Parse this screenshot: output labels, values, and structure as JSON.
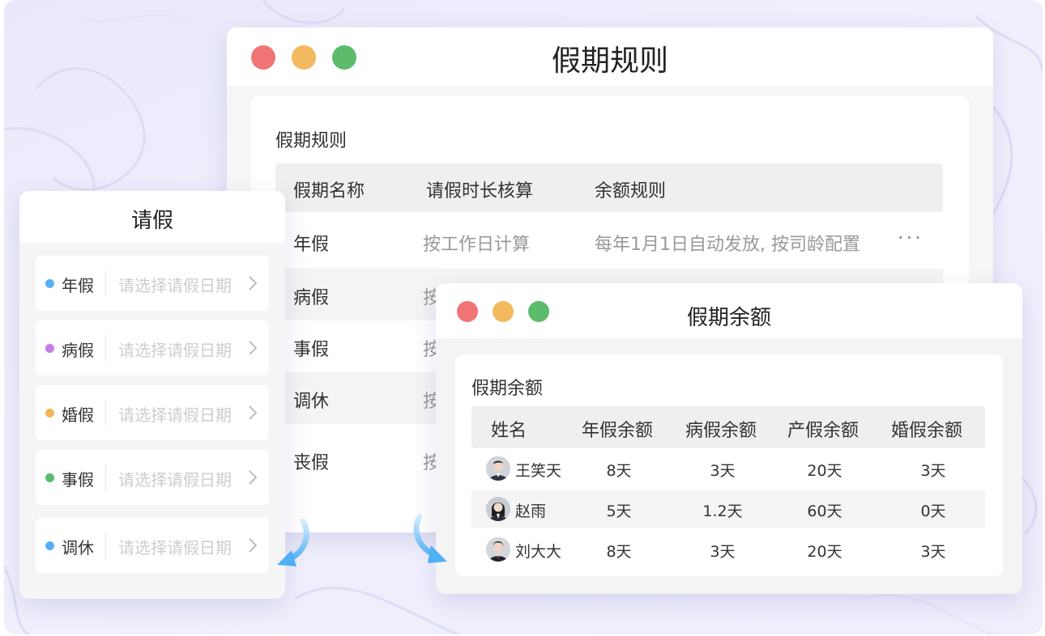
{
  "rules_window": {
    "title": "假期规则",
    "heading": "假期规则",
    "columns": [
      "假期名称",
      "请假时长核算",
      "余额规则"
    ],
    "rows": [
      {
        "name": "年假",
        "calc": "按工作日计算",
        "rule": "每年1月1日自动发放, 按司龄配置"
      },
      {
        "name": "病假",
        "calc": "按",
        "rule": ""
      },
      {
        "name": "事假",
        "calc": "按",
        "rule": ""
      },
      {
        "name": "调休",
        "calc": "按",
        "rule": ""
      },
      {
        "name": "丧假",
        "calc": "按",
        "rule": ""
      }
    ],
    "more_label": "···"
  },
  "leave_window": {
    "title": "请假",
    "items": [
      {
        "type": "年假",
        "placeholder": "请选择请假日期",
        "dot_color": "#5aaef5"
      },
      {
        "type": "病假",
        "placeholder": "请选择请假日期",
        "dot_color": "#c57be8"
      },
      {
        "type": "婚假",
        "placeholder": "请选择请假日期",
        "dot_color": "#f2b857"
      },
      {
        "type": "事假",
        "placeholder": "请选择请假日期",
        "dot_color": "#5cbc6b"
      },
      {
        "type": "调休",
        "placeholder": "请选择请假日期",
        "dot_color": "#5aaef5"
      }
    ]
  },
  "balance_window": {
    "title": "假期余额",
    "heading": "假期余额",
    "columns": [
      "姓名",
      "年假余额",
      "病假余额",
      "产假余额",
      "婚假余额"
    ],
    "rows": [
      {
        "name": "王笑天",
        "annual": "8天",
        "sick": "3天",
        "maternity": "20天",
        "marriage": "3天"
      },
      {
        "name": "赵雨",
        "annual": "5天",
        "sick": "1.2天",
        "maternity": "60天",
        "marriage": "0天"
      },
      {
        "name": "刘大大",
        "annual": "8天",
        "sick": "3天",
        "maternity": "20天",
        "marriage": "3天"
      }
    ]
  },
  "colors": {
    "window_close": "#f07474",
    "window_minimize": "#f3b95e",
    "window_maximize": "#5cbc6b",
    "arrow": "#5ab4f5"
  }
}
